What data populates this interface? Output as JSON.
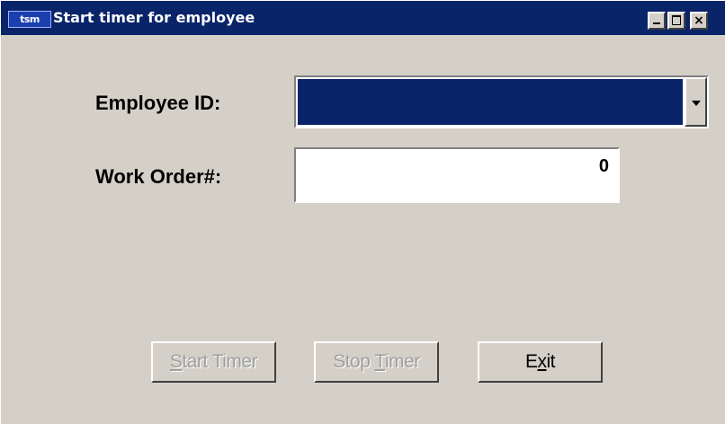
{
  "window": {
    "app_icon": "tsm",
    "title": "Start timer for employee",
    "controls": {
      "minimize": "minimize-icon",
      "maximize": "maximize-icon",
      "close": "×"
    }
  },
  "form": {
    "employee_id_label": "Employee ID:",
    "employee_id_value": "",
    "work_order_label": "Work Order#:",
    "work_order_value": "0"
  },
  "buttons": {
    "start_timer": {
      "label": "Start Timer",
      "mnemonic": "S",
      "enabled": false
    },
    "stop_timer": {
      "label": "Stop Timer",
      "mnemonic": "T",
      "enabled": false
    },
    "exit": {
      "label": "Exit",
      "mnemonic": "x",
      "enabled": true
    }
  },
  "colors": {
    "titlebar": "#0a246a",
    "face": "#d4d0c8",
    "selection": "#0a246a"
  }
}
